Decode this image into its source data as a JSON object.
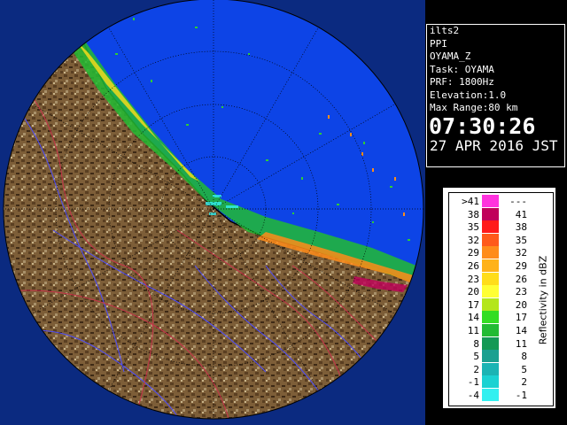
{
  "info": {
    "radar": "ilts2",
    "scan_type": "PPI",
    "product": "OYAMA_Z",
    "task": "Task: OYAMA",
    "prf": "PRF: 1800Hz",
    "elevation": "Elevation:1.0",
    "max_range": "Max Range:80 km",
    "time": "07:30:26",
    "date": "27 APR 2016 JST"
  },
  "legend": {
    "title": "Reflectivity in dBZ",
    "rows": [
      {
        "lo": ">41",
        "hi": "---",
        "color": "#ff33dd"
      },
      {
        "lo": "38",
        "hi": "41",
        "color": "#c0005a"
      },
      {
        "lo": "35",
        "hi": "38",
        "color": "#ff1a1a"
      },
      {
        "lo": "32",
        "hi": "35",
        "color": "#ff5a1a"
      },
      {
        "lo": "29",
        "hi": "32",
        "color": "#ff8c1a"
      },
      {
        "lo": "26",
        "hi": "29",
        "color": "#ffb21a"
      },
      {
        "lo": "23",
        "hi": "26",
        "color": "#ffdd1a"
      },
      {
        "lo": "20",
        "hi": "23",
        "color": "#ffff33"
      },
      {
        "lo": "17",
        "hi": "20",
        "color": "#b4e61a"
      },
      {
        "lo": "14",
        "hi": "17",
        "color": "#33dd22"
      },
      {
        "lo": "11",
        "hi": "14",
        "color": "#22bb33"
      },
      {
        "lo": "8",
        "hi": "11",
        "color": "#149955"
      },
      {
        "lo": "5",
        "hi": "8",
        "color": "#1aa090"
      },
      {
        "lo": "2",
        "hi": "5",
        "color": "#1ab4b4"
      },
      {
        "lo": "-1",
        "hi": "2",
        "color": "#1ad2d2"
      },
      {
        "lo": "-4",
        "hi": "-1",
        "color": "#33f0f0"
      }
    ]
  },
  "colors": {
    "sea": "#0d44e6",
    "land": "#7a5a36",
    "coast": "#000000",
    "river": "#4d4dff",
    "border": "#c8324a"
  }
}
